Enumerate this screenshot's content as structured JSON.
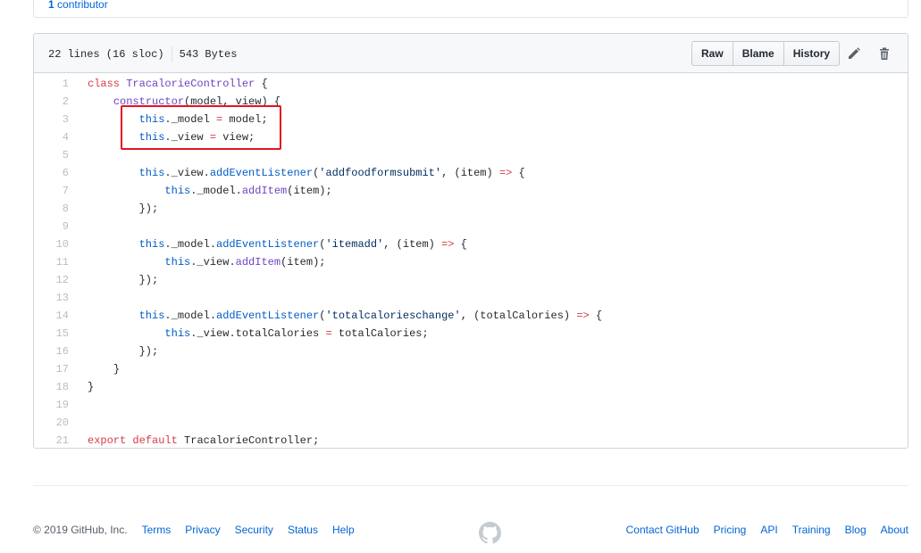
{
  "contributors": {
    "count": "1",
    "label": "contributor"
  },
  "file_header": {
    "lines": "22 lines (16 sloc)",
    "size": "543 Bytes",
    "buttons": {
      "raw": "Raw",
      "blame": "Blame",
      "history": "History"
    }
  },
  "code_lines": [
    {
      "n": "1"
    },
    {
      "n": "2"
    },
    {
      "n": "3"
    },
    {
      "n": "4"
    },
    {
      "n": "5"
    },
    {
      "n": "6"
    },
    {
      "n": "7"
    },
    {
      "n": "8"
    },
    {
      "n": "9"
    },
    {
      "n": "10"
    },
    {
      "n": "11"
    },
    {
      "n": "12"
    },
    {
      "n": "13"
    },
    {
      "n": "14"
    },
    {
      "n": "15"
    },
    {
      "n": "16"
    },
    {
      "n": "17"
    },
    {
      "n": "18"
    },
    {
      "n": "19"
    },
    {
      "n": "20"
    },
    {
      "n": "21"
    }
  ],
  "code_tokens": {
    "class": "class",
    "TracalorieController": "TracalorieController",
    "brace_open": " {",
    "constructor": "constructor",
    "ctor_args": "(model, view) {",
    "this": "this",
    "_model_assign": "._model ",
    "eq": "=",
    "model_end": " model;",
    "_view_assign": "._view ",
    "view_end": " view;",
    "_view": "._view.",
    "_model": "._model.",
    "addEventListener": "addEventListener",
    "str_addfood": "'addfoodformsubmit'",
    "str_itemadd": "'itemadd'",
    "str_totalcal": "'totalcalorieschange'",
    "item_param": ", (item) ",
    "totalcal_param": ", (totalCalories) ",
    "arrow": "=>",
    "brace_tail": " {",
    "addItem": "addItem",
    "item_call": "(item);",
    "close_listener": "});",
    "totalCalories_prop": "._view.totalCalories ",
    "totalCalories_end": " totalCalories;",
    "close_brace": "}",
    "export": "export",
    "default": "default",
    "export_end": " TracalorieController;"
  },
  "footer": {
    "copyright": "© 2019 GitHub, Inc.",
    "left_links": [
      "Terms",
      "Privacy",
      "Security",
      "Status",
      "Help"
    ],
    "right_links": [
      "Contact GitHub",
      "Pricing",
      "API",
      "Training",
      "Blog",
      "About"
    ]
  },
  "colors": {
    "keyword": "#d73a49",
    "entity": "#6f42c1",
    "constant": "#005cc5",
    "string": "#032f62",
    "link": "#0366d6",
    "highlight": "#e3131f"
  }
}
